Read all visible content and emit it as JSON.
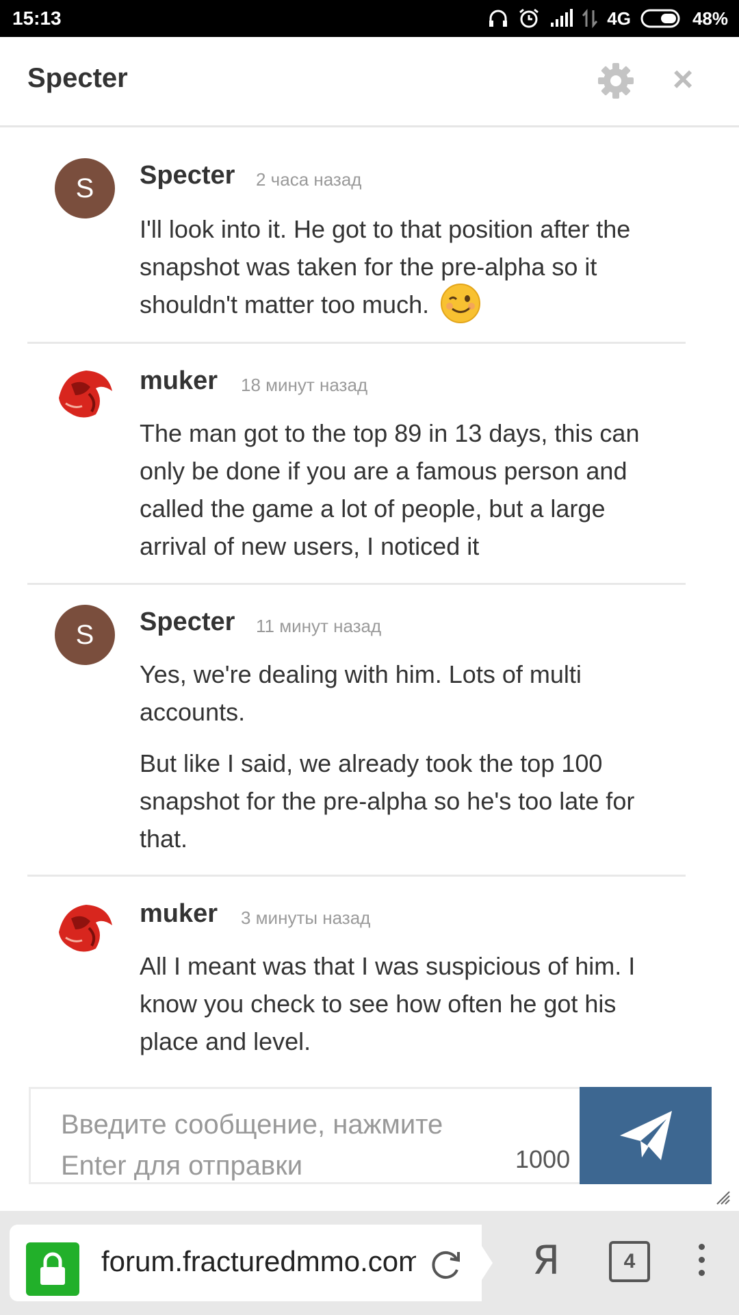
{
  "status_bar": {
    "time": "15:13",
    "network": "4G",
    "battery": "48%"
  },
  "header": {
    "title": "Specter"
  },
  "messages": [
    {
      "author": "Specter",
      "time": "2 часа назад",
      "avatar_letter": "S",
      "avatar_type": "letter",
      "paragraphs": [
        "I'll look into it. He got to that position after the snapshot was taken for the pre-alpha so it shouldn't matter too much."
      ],
      "emoji": "winking-face"
    },
    {
      "author": "muker",
      "time": "18 минут назад",
      "avatar_type": "image",
      "paragraphs": [
        "The man got to the top 89 in 13 days, this can only be done if you are a famous person and called the game a lot of people, but a large arrival of new users, I noticed it"
      ]
    },
    {
      "author": "Specter",
      "time": "11 минут назад",
      "avatar_letter": "S",
      "avatar_type": "letter",
      "paragraphs": [
        "Yes, we're dealing with him. Lots of multi accounts.",
        "But like I said, we already took the top 100 snapshot for the pre-alpha so he's too late for that."
      ]
    },
    {
      "author": "muker",
      "time": "3 минуты назад",
      "avatar_type": "image",
      "paragraphs": [
        "All I meant was that I was suspicious of him. I know you check to see how often he got his place and level."
      ]
    }
  ],
  "composer": {
    "placeholder": "Введите сообщение, нажмите Enter для отправки",
    "char_counter": "1000"
  },
  "browser": {
    "url": "forum.fracturedmmo.com",
    "tab_count": "4",
    "yandex_label": "Я"
  },
  "colors": {
    "send_button": "#3d6791",
    "avatar_letter_bg": "#7a4e3d",
    "lock_green": "#22b02a"
  }
}
